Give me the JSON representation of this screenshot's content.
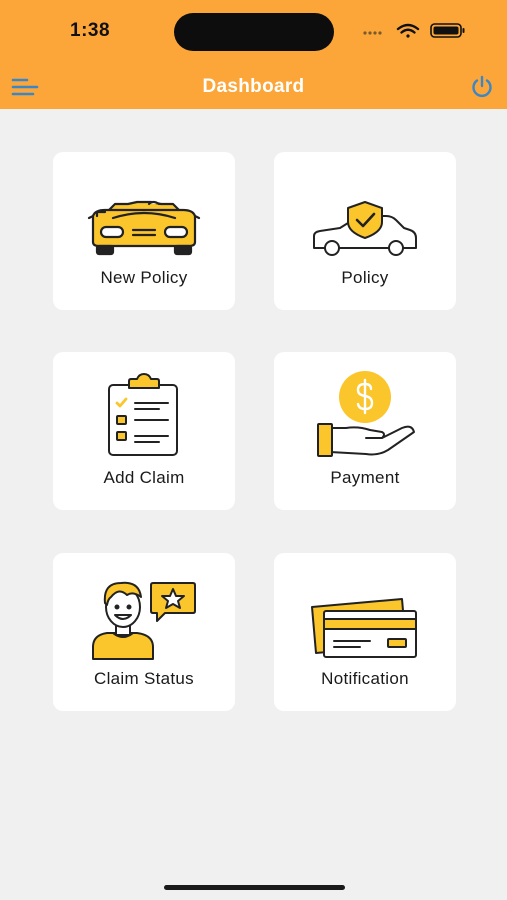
{
  "status_bar": {
    "time": "1:38"
  },
  "header": {
    "title": "Dashboard",
    "menu_icon": "menu-icon",
    "power_icon": "power-icon"
  },
  "colors": {
    "accent": "#fca63a",
    "icon_yellow": "#fbc52c",
    "outline": "#222222",
    "menu_blue": "#3d86c6"
  },
  "tiles": [
    {
      "label": "New Policy",
      "icon": "car-icon"
    },
    {
      "label": "Policy",
      "icon": "car-shield-icon"
    },
    {
      "label": "Add Claim",
      "icon": "clipboard-checklist-icon"
    },
    {
      "label": "Payment",
      "icon": "hand-coin-icon"
    },
    {
      "label": "Claim Status",
      "icon": "person-star-icon"
    },
    {
      "label": "Notification",
      "icon": "credit-cards-icon"
    }
  ]
}
